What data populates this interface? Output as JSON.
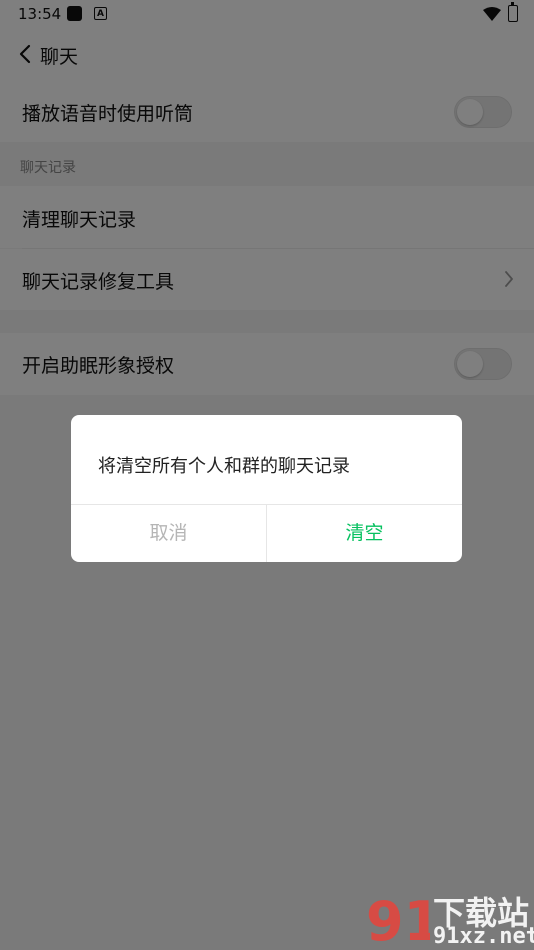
{
  "status_bar": {
    "time": "13:54",
    "notification_icon": "square-icon",
    "a_icon_label": "A"
  },
  "header": {
    "back_icon": "chevron-left-icon",
    "title": "聊天"
  },
  "settings": {
    "play_voice_earpiece": {
      "label": "播放语音时使用听筒",
      "enabled": false
    },
    "section_chat_records": "聊天记录",
    "clear_chat_records": {
      "label": "清理聊天记录"
    },
    "repair_tool": {
      "label": "聊天记录修复工具"
    },
    "sleep_aid_avatar": {
      "label": "开启助眠形象授权",
      "enabled": false
    }
  },
  "dialog": {
    "message": "将清空所有个人和群的聊天记录",
    "cancel_label": "取消",
    "confirm_label": "清空",
    "confirm_color": "#07c160"
  },
  "watermark": {
    "line1": "下载站",
    "line2": "91xz.net",
    "logo": "91"
  }
}
